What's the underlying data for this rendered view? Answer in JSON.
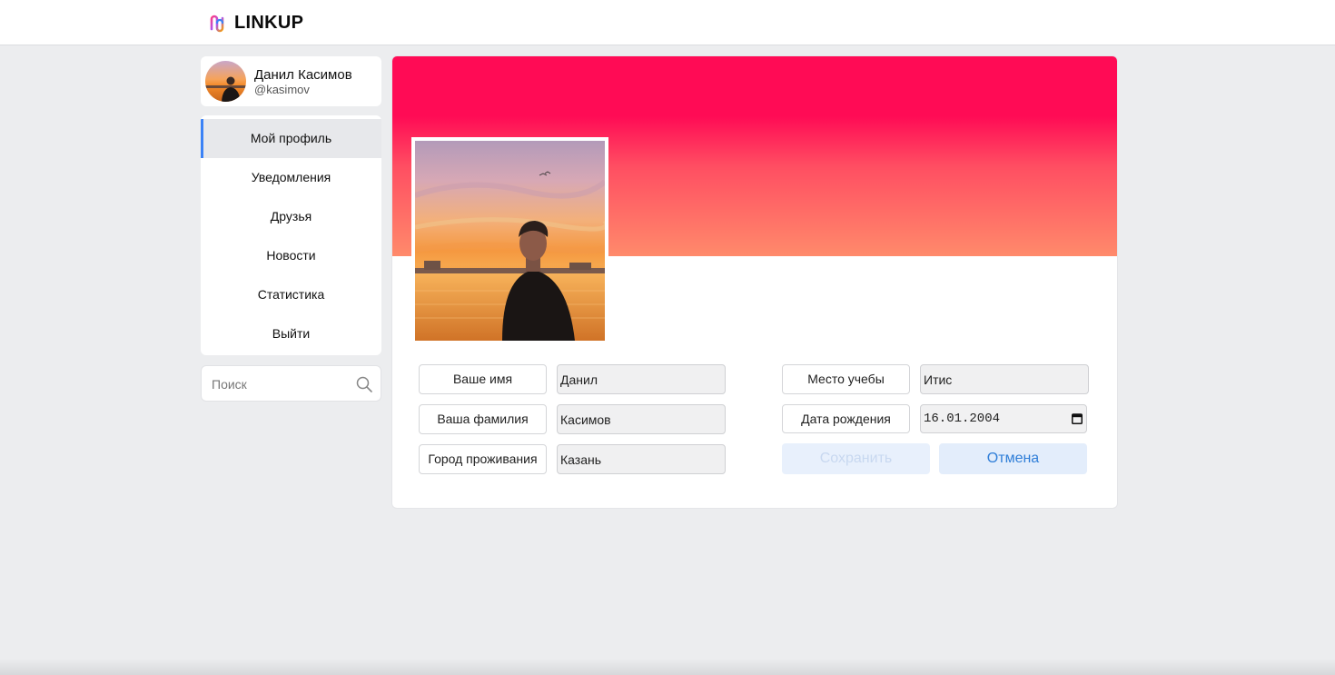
{
  "header": {
    "logo_text": "LINKUP",
    "logo_icon": "linkup-logo-icon"
  },
  "profile_card": {
    "name": "Данил Касимов",
    "handle": "@kasimov"
  },
  "nav": {
    "items": [
      {
        "label": "Мой профиль",
        "active": true
      },
      {
        "label": "Уведомления",
        "active": false
      },
      {
        "label": "Друзья",
        "active": false
      },
      {
        "label": "Новости",
        "active": false
      },
      {
        "label": "Статистика",
        "active": false
      },
      {
        "label": "Выйти",
        "active": false
      }
    ]
  },
  "search": {
    "placeholder": "Поиск",
    "icon": "search-icon"
  },
  "form": {
    "first_name": {
      "label": "Ваше имя",
      "value": "Данил"
    },
    "last_name": {
      "label": "Ваша фамилия",
      "value": "Касимов"
    },
    "city": {
      "label": "Город проживания",
      "value": "Казань"
    },
    "study": {
      "label": "Место учебы",
      "value": "Итис"
    },
    "birthday": {
      "label": "Дата рождения",
      "value": "16.01.2004"
    },
    "save_label": "Сохранить",
    "cancel_label": "Отмена"
  },
  "colors": {
    "accent": "#3b82f6",
    "cover_top": "#ff0b55",
    "cover_bottom": "#ff8a6b",
    "cancel_text": "#2f7ed8"
  }
}
